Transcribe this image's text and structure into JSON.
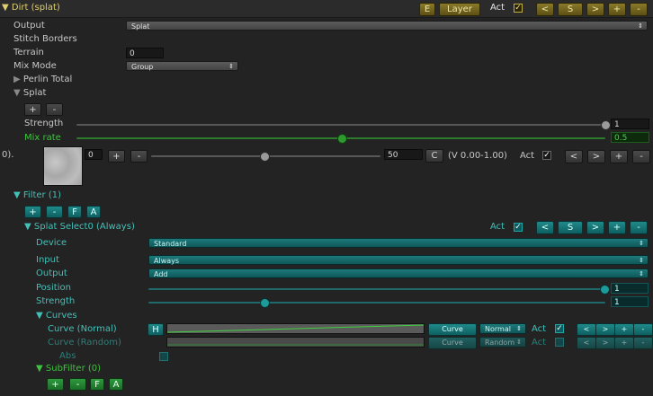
{
  "header": {
    "title": "Dirt (splat)",
    "btn_e": "E",
    "btn_layer": "Layer",
    "act_label": "Act",
    "nav_prev": "<",
    "nav_s": "S",
    "nav_next": ">",
    "nav_add": "+",
    "nav_remove": "-"
  },
  "props": {
    "output_label": "Output",
    "output_value": "Splat",
    "stitch_label": "Stitch Borders",
    "terrain_label": "Terrain",
    "terrain_value": "0",
    "mixmode_label": "Mix Mode",
    "mixmode_value": "Group",
    "perlin_label": "Perlin Total",
    "splat_label": "Splat"
  },
  "splat": {
    "add": "+",
    "remove": "-",
    "strength_label": "Strength",
    "strength_value": "1",
    "strength_fraction": 1.0,
    "mixrate_label": "Mix rate",
    "mixrate_value": "0.5",
    "mixrate_fraction": 0.5,
    "row_label": "0).",
    "index_value": "0",
    "slider_value": "50",
    "slider_fraction": 0.5,
    "btn_c": "C",
    "range_text": "(V 0.00-1.00)",
    "act_label": "Act"
  },
  "filter": {
    "label": "Filter (1)",
    "add": "+",
    "remove": "-",
    "f": "F",
    "a": "A",
    "select_label": "Splat Select0 (Always)",
    "act_label": "Act",
    "device_label": "Device",
    "device_value": "Standard",
    "input_label": "Input",
    "input_value": "Always",
    "output_label": "Output",
    "output_value": "Add",
    "position_label": "Position",
    "position_value": "1",
    "position_fraction": 1.0,
    "strength_label": "Strength",
    "strength_value": "1",
    "strength_fraction": 0.25,
    "curves_label": "Curves",
    "curve_normal_label": "Curve (Normal)",
    "curve_random_label": "Curve (Random)",
    "btn_h": "H",
    "curve_btn": "Curve",
    "normal_value": "Normal",
    "random_value": "Random",
    "abs_label": "Abs",
    "subfilter_label": "SubFilter (0)"
  },
  "colors": {
    "header_yellow": "#e0cf6e",
    "teal_label": "#42c0b8",
    "green_label": "#3fc23f"
  }
}
